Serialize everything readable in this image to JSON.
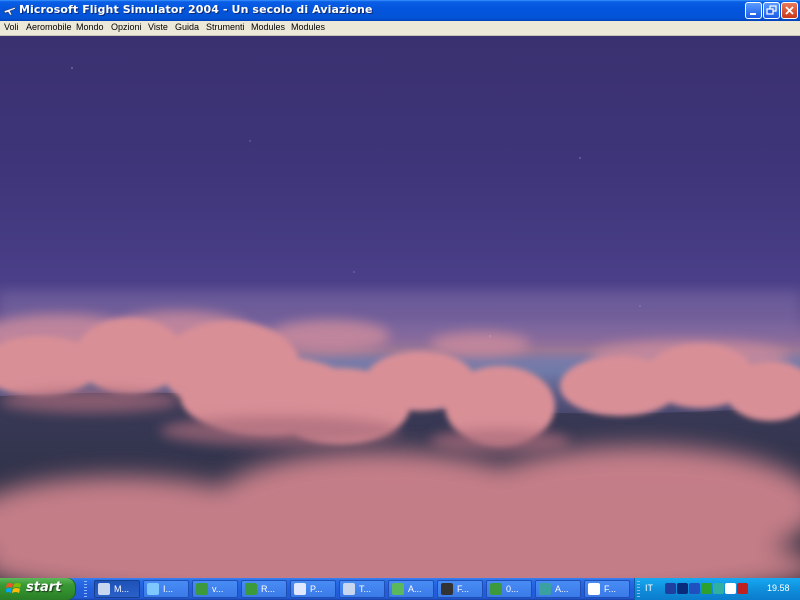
{
  "window": {
    "title": "Microsoft Flight Simulator 2004 - Un secolo di Aviazione",
    "app_icon": "plane-icon"
  },
  "menubar": {
    "items": [
      "Voli",
      "Aeromobile",
      "Mondo",
      "Opzioni",
      "Viste",
      "Guida",
      "Strumenti",
      "Modules",
      "Modules"
    ]
  },
  "taskbar": {
    "start_label": "start",
    "tasks": [
      {
        "label": "M...",
        "icon": "plane-icon",
        "active": true
      },
      {
        "label": "I...",
        "icon": "browser-icon"
      },
      {
        "label": "v...",
        "icon": "excel-icon"
      },
      {
        "label": "R...",
        "icon": "excel-icon"
      },
      {
        "label": "P...",
        "icon": "window-icon"
      },
      {
        "label": "T...",
        "icon": "plane-icon"
      },
      {
        "label": "A...",
        "icon": "network-icon"
      },
      {
        "label": "F...",
        "icon": "monitor-icon"
      },
      {
        "label": "0...",
        "icon": "excel-icon"
      },
      {
        "label": "A...",
        "icon": "app-icon"
      },
      {
        "label": "F...",
        "icon": "document-icon"
      }
    ],
    "tray": {
      "language": "IT",
      "clock": "19.58",
      "icons": [
        "speaker-icon",
        "network-icon",
        "media-icon",
        "update-icon",
        "user-icon",
        "display-icon",
        "ati-icon"
      ]
    }
  },
  "colors": {
    "titlebar": "#0355dd",
    "taskbar": "#245edb",
    "start": "#3a9a35",
    "tray": "#0f8fdc",
    "sky": "#3e357a",
    "clouds": "#d88a92"
  }
}
